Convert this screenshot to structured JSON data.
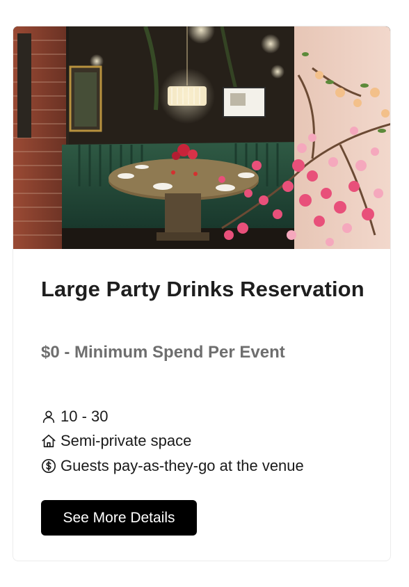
{
  "card": {
    "image_alt": "Restaurant private dining booth with round table, chandelier and pink blossoms",
    "title": "Large Party Drinks Reservation",
    "price_line": "$0 - Minimum Spend Per Event",
    "features": [
      {
        "icon": "person-icon",
        "text": "10 - 30"
      },
      {
        "icon": "house-icon",
        "text": "Semi-private space"
      },
      {
        "icon": "dollar-circle-icon",
        "text": "Guests pay-as-they-go at the venue"
      }
    ],
    "button_label": "See More Details"
  },
  "colors": {
    "button_bg": "#000000",
    "button_text": "#ffffff",
    "price_text": "#6e6e6e",
    "title_text": "#1e1e1e"
  }
}
